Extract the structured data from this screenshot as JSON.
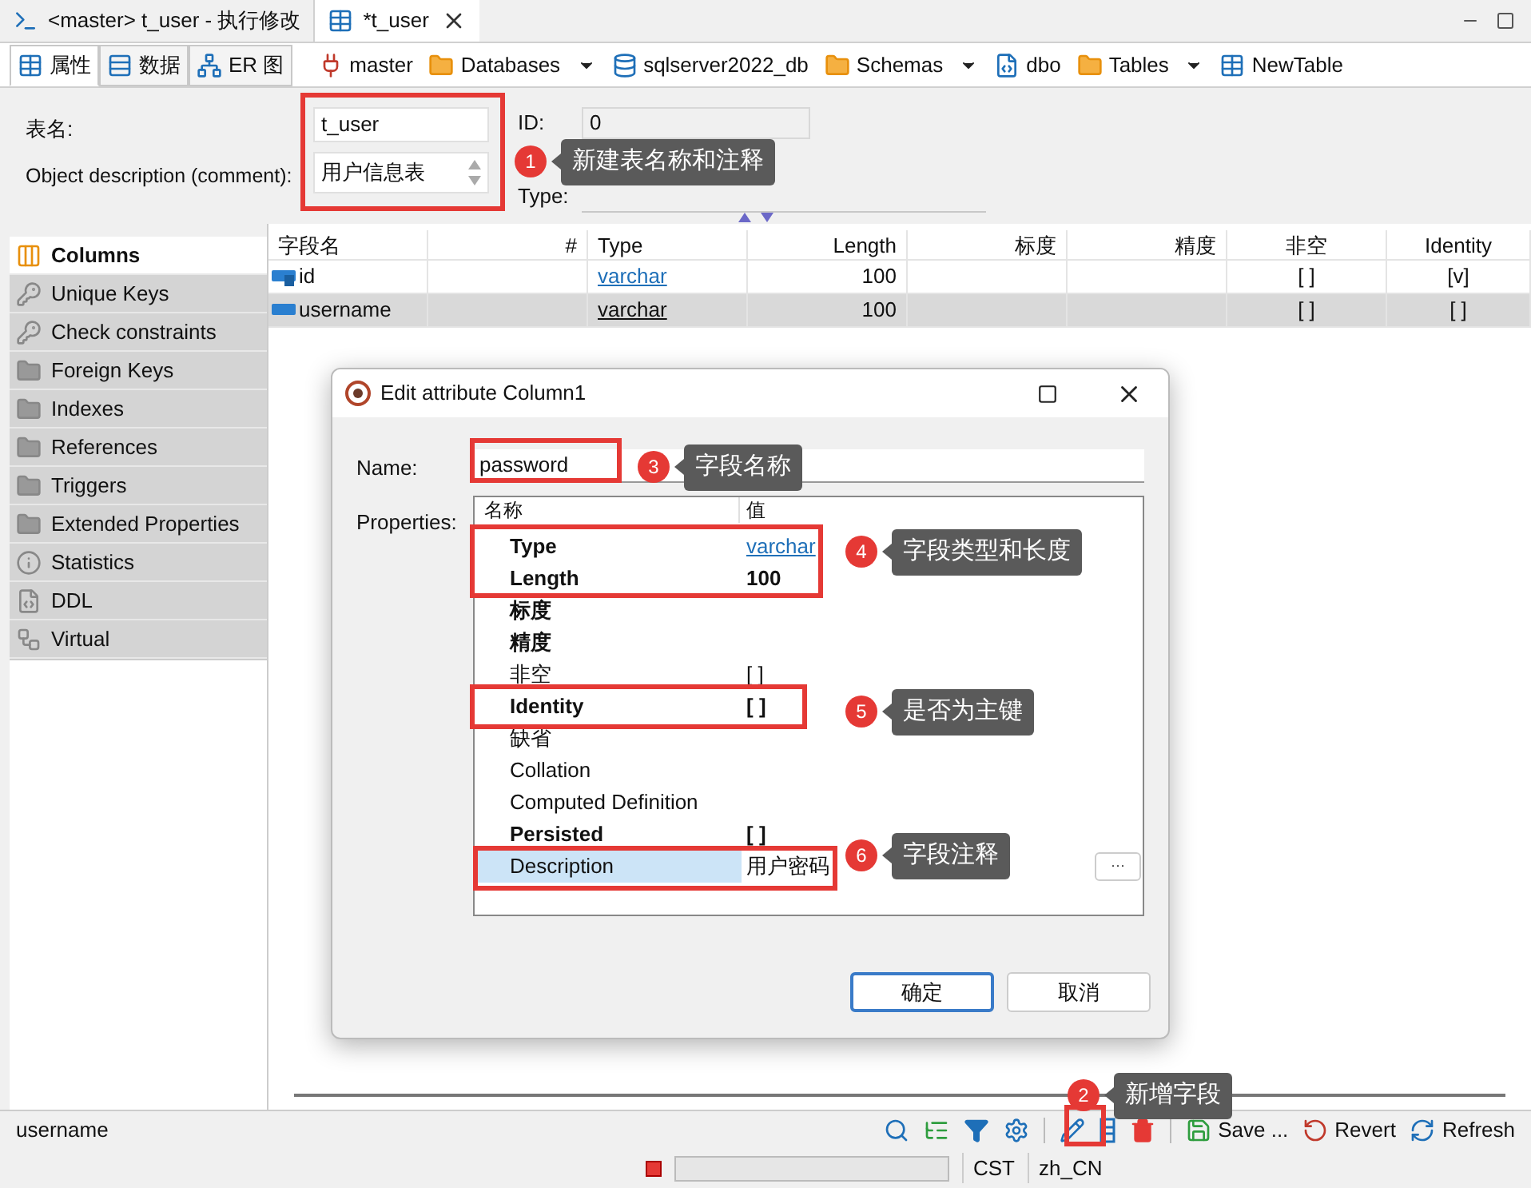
{
  "editor_tabs": [
    {
      "label": "<master> t_user - 执行修改",
      "selected": false,
      "kind": "script"
    },
    {
      "label": "*t_user",
      "selected": true,
      "kind": "table"
    }
  ],
  "view_tabs": [
    {
      "label": "属性",
      "selected": true,
      "kind": "props"
    },
    {
      "label": "数据",
      "selected": false,
      "kind": "data"
    },
    {
      "label": "ER 图",
      "selected": false,
      "kind": "er"
    }
  ],
  "breadcrumb": [
    {
      "label": "master",
      "kind": "connection",
      "dropdown": false
    },
    {
      "label": "Databases",
      "kind": "folder",
      "dropdown": true
    },
    {
      "label": "sqlserver2022_db",
      "kind": "database",
      "dropdown": false
    },
    {
      "label": "Schemas",
      "kind": "folder",
      "dropdown": true
    },
    {
      "label": "dbo",
      "kind": "schema",
      "dropdown": false
    },
    {
      "label": "Tables",
      "kind": "folder",
      "dropdown": true
    },
    {
      "label": "NewTable",
      "kind": "table",
      "dropdown": false
    }
  ],
  "properties": {
    "table_name_label": "表名:",
    "table_name": "t_user",
    "description_label": "Object description (comment):",
    "description": "用户信息表",
    "id_label": "ID:",
    "id": "0",
    "type_label": "Type:"
  },
  "sections": [
    {
      "label": "Columns",
      "kind": "columns",
      "selected": true
    },
    {
      "label": "Unique Keys",
      "kind": "key",
      "selected": false
    },
    {
      "label": "Check constraints",
      "kind": "key",
      "selected": false
    },
    {
      "label": "Foreign Keys",
      "kind": "folder",
      "selected": false
    },
    {
      "label": "Indexes",
      "kind": "folder",
      "selected": false
    },
    {
      "label": "References",
      "kind": "folder",
      "selected": false
    },
    {
      "label": "Triggers",
      "kind": "folder",
      "selected": false
    },
    {
      "label": "Extended Properties",
      "kind": "folder",
      "selected": false
    },
    {
      "label": "Statistics",
      "kind": "info",
      "selected": false
    },
    {
      "label": "DDL",
      "kind": "ddl",
      "selected": false
    },
    {
      "label": "Virtual",
      "kind": "virtual",
      "selected": false
    }
  ],
  "table": {
    "columns": [
      "字段名",
      "#",
      "Type",
      "Length",
      "标度",
      "精度",
      "非空",
      "Identity"
    ],
    "rows": [
      {
        "kind": "key",
        "selected": false,
        "cells": [
          "id",
          "",
          "varchar",
          "100",
          "",
          "",
          "[ ]",
          "[v]"
        ]
      },
      {
        "kind": "text",
        "selected": true,
        "cells": [
          "username",
          "",
          "varchar",
          "100",
          "",
          "",
          "[ ]",
          "[ ]"
        ]
      }
    ]
  },
  "dialog": {
    "title": "Edit attribute Column1",
    "name_label": "Name:",
    "name": "password",
    "properties_label": "Properties:",
    "columns": [
      "名称",
      "值"
    ],
    "rows": [
      {
        "name": "Type",
        "value": "varchar",
        "bold": true,
        "kind": "link",
        "selected": false
      },
      {
        "name": "Length",
        "value": "100",
        "bold": true,
        "kind": "text",
        "selected": false
      },
      {
        "name": "标度",
        "value": "",
        "bold": true,
        "kind": "text",
        "selected": false
      },
      {
        "name": "精度",
        "value": "",
        "bold": true,
        "kind": "text",
        "selected": false
      },
      {
        "name": "非空",
        "value": "[ ]",
        "bold": false,
        "kind": "text",
        "selected": false
      },
      {
        "name": "Identity",
        "value": "[ ]",
        "bold": true,
        "kind": "text",
        "selected": false
      },
      {
        "name": "缺省",
        "value": "",
        "bold": false,
        "kind": "text",
        "selected": false
      },
      {
        "name": "Collation",
        "value": "",
        "bold": false,
        "kind": "text",
        "selected": false
      },
      {
        "name": "Computed Definition",
        "value": "",
        "bold": false,
        "kind": "text",
        "selected": false
      },
      {
        "name": "Persisted",
        "value": "[ ]",
        "bold": true,
        "kind": "text",
        "selected": false
      },
      {
        "name": "Description",
        "value": "用户密码",
        "bold": false,
        "kind": "text",
        "selected": true
      }
    ],
    "ellipsis": "···",
    "buttons": [
      {
        "label": "确定",
        "primary": true
      },
      {
        "label": "取消",
        "primary": false
      }
    ]
  },
  "annotations": [
    {
      "number": "1",
      "text": "新建表名称和注释"
    },
    {
      "number": "2",
      "text": "新增字段"
    },
    {
      "number": "3",
      "text": "字段名称"
    },
    {
      "number": "4",
      "text": "字段类型和长度"
    },
    {
      "number": "5",
      "text": "是否为主键"
    },
    {
      "number": "6",
      "text": "字段注释"
    }
  ],
  "toolbar": {
    "status": "username",
    "actions": [
      {
        "label": "Save ...",
        "kind": "save"
      },
      {
        "label": "Revert",
        "kind": "revert"
      },
      {
        "label": "Refresh",
        "kind": "refresh"
      }
    ]
  },
  "status_bar": [
    "CST",
    "zh_CN"
  ]
}
